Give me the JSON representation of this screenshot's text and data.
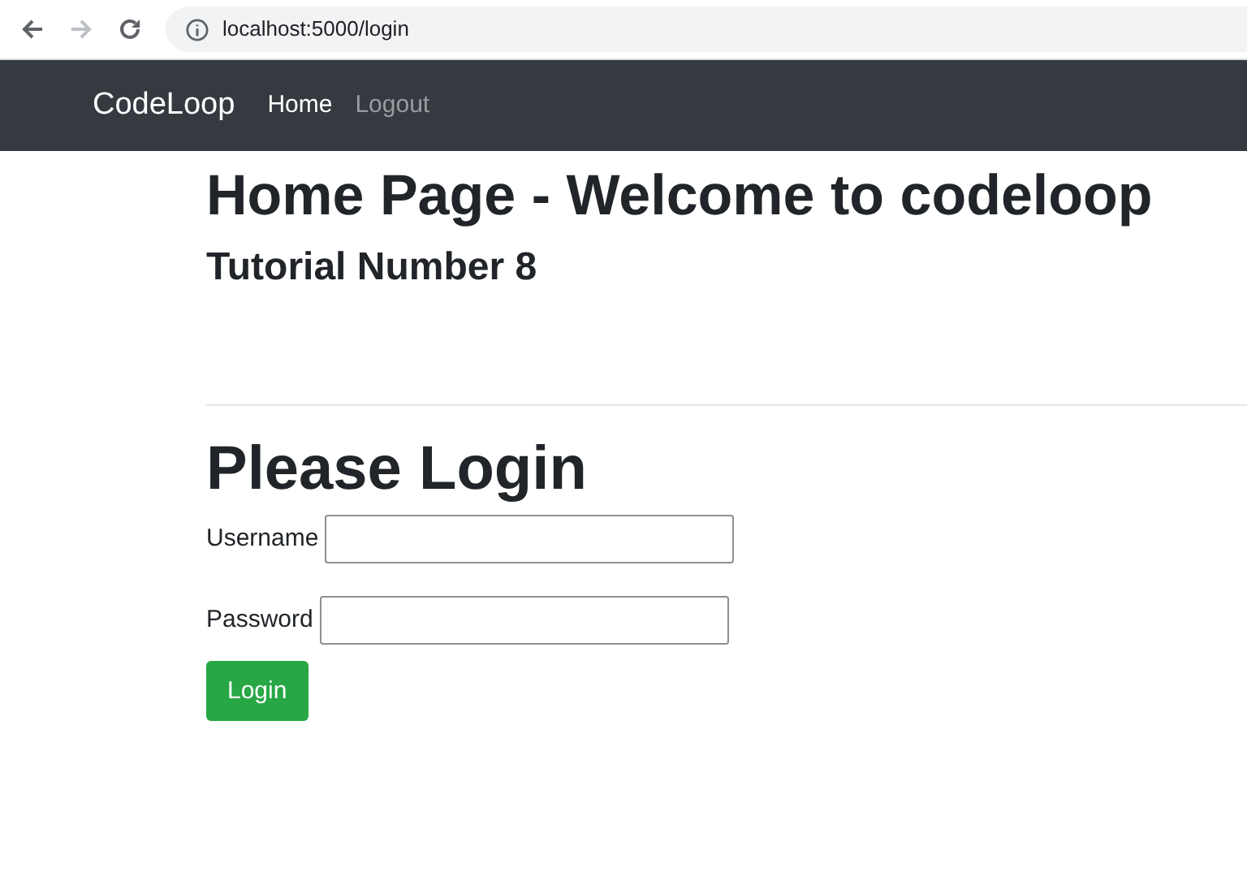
{
  "browser": {
    "back": {
      "disabled": false
    },
    "forward": {
      "disabled": true
    },
    "url": "localhost:5000/login"
  },
  "navbar": {
    "brand": "CodeLoop",
    "items": [
      {
        "label": "Home",
        "selected": true
      },
      {
        "label": "Logout",
        "selected": false
      }
    ]
  },
  "header": {
    "title": "Home Page - Welcome to codeloop",
    "subtitle": "Tutorial Number 8"
  },
  "login": {
    "title": "Please Login",
    "fields": [
      {
        "label": "Username"
      },
      {
        "label": "Password"
      }
    ],
    "button": "Login"
  }
}
